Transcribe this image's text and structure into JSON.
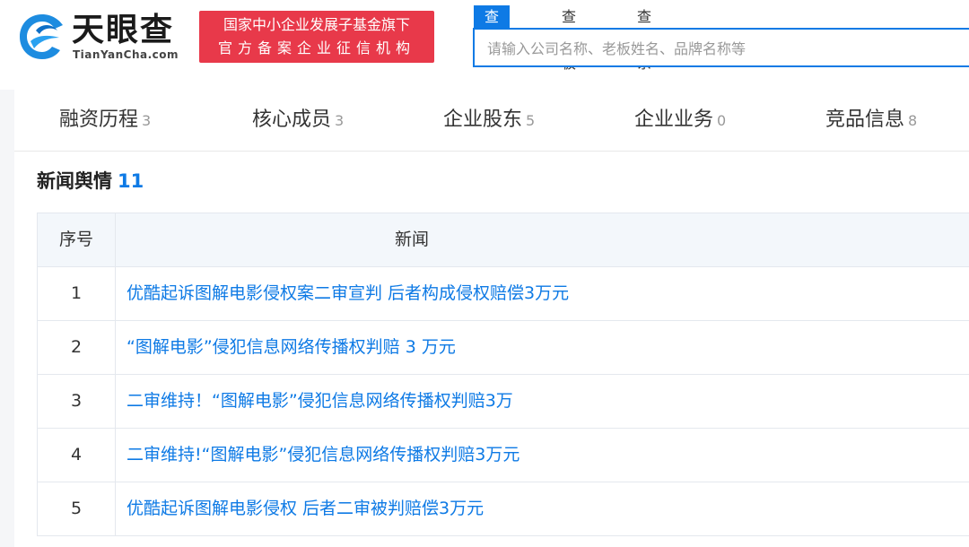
{
  "header": {
    "logo_text": "天眼查",
    "logo_sub": "TianYanCha.com",
    "badge_line1": "国家中小企业发展子基金旗下",
    "badge_line2": "官方备案企业征信机构",
    "search_tabs": [
      "查公司",
      "查老板",
      "查关系"
    ],
    "search_placeholder": "请输入公司名称、老板姓名、品牌名称等",
    "accent": "#0e7ae5",
    "badge_color": "#e8394a"
  },
  "nav_tabs": [
    {
      "label": "融资历程",
      "count": "3"
    },
    {
      "label": "核心成员",
      "count": "3"
    },
    {
      "label": "企业股东",
      "count": "5"
    },
    {
      "label": "企业业务",
      "count": "0"
    },
    {
      "label": "竞品信息",
      "count": "8"
    }
  ],
  "section": {
    "title": "新闻舆情",
    "count": "11"
  },
  "table": {
    "headers": [
      "序号",
      "新闻"
    ],
    "rows": [
      {
        "idx": "1",
        "news": "优酷起诉图解电影侵权案二审宣判 后者构成侵权赔偿3万元"
      },
      {
        "idx": "2",
        "news": "“图解电影”侵犯信息网络传播权判赔 3 万元"
      },
      {
        "idx": "3",
        "news": "二审维持！“图解电影”侵犯信息网络传播权判赔3万"
      },
      {
        "idx": "4",
        "news": "二审维持!“图解电影”侵犯信息网络传播权判赔3万元"
      },
      {
        "idx": "5",
        "news": "优酷起诉图解电影侵权 后者二审被判赔偿3万元"
      }
    ]
  }
}
